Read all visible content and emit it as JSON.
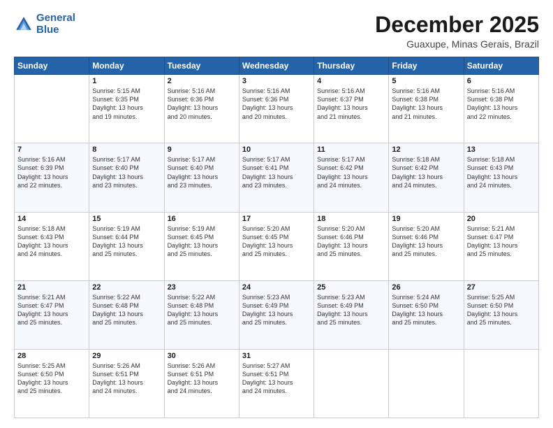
{
  "header": {
    "logo_line1": "General",
    "logo_line2": "Blue",
    "month": "December 2025",
    "location": "Guaxupe, Minas Gerais, Brazil"
  },
  "days_of_week": [
    "Sunday",
    "Monday",
    "Tuesday",
    "Wednesday",
    "Thursday",
    "Friday",
    "Saturday"
  ],
  "weeks": [
    [
      {
        "day": "",
        "info": ""
      },
      {
        "day": "1",
        "info": "Sunrise: 5:15 AM\nSunset: 6:35 PM\nDaylight: 13 hours\nand 19 minutes."
      },
      {
        "day": "2",
        "info": "Sunrise: 5:16 AM\nSunset: 6:36 PM\nDaylight: 13 hours\nand 20 minutes."
      },
      {
        "day": "3",
        "info": "Sunrise: 5:16 AM\nSunset: 6:36 PM\nDaylight: 13 hours\nand 20 minutes."
      },
      {
        "day": "4",
        "info": "Sunrise: 5:16 AM\nSunset: 6:37 PM\nDaylight: 13 hours\nand 21 minutes."
      },
      {
        "day": "5",
        "info": "Sunrise: 5:16 AM\nSunset: 6:38 PM\nDaylight: 13 hours\nand 21 minutes."
      },
      {
        "day": "6",
        "info": "Sunrise: 5:16 AM\nSunset: 6:38 PM\nDaylight: 13 hours\nand 22 minutes."
      }
    ],
    [
      {
        "day": "7",
        "info": "Sunrise: 5:16 AM\nSunset: 6:39 PM\nDaylight: 13 hours\nand 22 minutes."
      },
      {
        "day": "8",
        "info": "Sunrise: 5:17 AM\nSunset: 6:40 PM\nDaylight: 13 hours\nand 23 minutes."
      },
      {
        "day": "9",
        "info": "Sunrise: 5:17 AM\nSunset: 6:40 PM\nDaylight: 13 hours\nand 23 minutes."
      },
      {
        "day": "10",
        "info": "Sunrise: 5:17 AM\nSunset: 6:41 PM\nDaylight: 13 hours\nand 23 minutes."
      },
      {
        "day": "11",
        "info": "Sunrise: 5:17 AM\nSunset: 6:42 PM\nDaylight: 13 hours\nand 24 minutes."
      },
      {
        "day": "12",
        "info": "Sunrise: 5:18 AM\nSunset: 6:42 PM\nDaylight: 13 hours\nand 24 minutes."
      },
      {
        "day": "13",
        "info": "Sunrise: 5:18 AM\nSunset: 6:43 PM\nDaylight: 13 hours\nand 24 minutes."
      }
    ],
    [
      {
        "day": "14",
        "info": "Sunrise: 5:18 AM\nSunset: 6:43 PM\nDaylight: 13 hours\nand 24 minutes."
      },
      {
        "day": "15",
        "info": "Sunrise: 5:19 AM\nSunset: 6:44 PM\nDaylight: 13 hours\nand 25 minutes."
      },
      {
        "day": "16",
        "info": "Sunrise: 5:19 AM\nSunset: 6:45 PM\nDaylight: 13 hours\nand 25 minutes."
      },
      {
        "day": "17",
        "info": "Sunrise: 5:20 AM\nSunset: 6:45 PM\nDaylight: 13 hours\nand 25 minutes."
      },
      {
        "day": "18",
        "info": "Sunrise: 5:20 AM\nSunset: 6:46 PM\nDaylight: 13 hours\nand 25 minutes."
      },
      {
        "day": "19",
        "info": "Sunrise: 5:20 AM\nSunset: 6:46 PM\nDaylight: 13 hours\nand 25 minutes."
      },
      {
        "day": "20",
        "info": "Sunrise: 5:21 AM\nSunset: 6:47 PM\nDaylight: 13 hours\nand 25 minutes."
      }
    ],
    [
      {
        "day": "21",
        "info": "Sunrise: 5:21 AM\nSunset: 6:47 PM\nDaylight: 13 hours\nand 25 minutes."
      },
      {
        "day": "22",
        "info": "Sunrise: 5:22 AM\nSunset: 6:48 PM\nDaylight: 13 hours\nand 25 minutes."
      },
      {
        "day": "23",
        "info": "Sunrise: 5:22 AM\nSunset: 6:48 PM\nDaylight: 13 hours\nand 25 minutes."
      },
      {
        "day": "24",
        "info": "Sunrise: 5:23 AM\nSunset: 6:49 PM\nDaylight: 13 hours\nand 25 minutes."
      },
      {
        "day": "25",
        "info": "Sunrise: 5:23 AM\nSunset: 6:49 PM\nDaylight: 13 hours\nand 25 minutes."
      },
      {
        "day": "26",
        "info": "Sunrise: 5:24 AM\nSunset: 6:50 PM\nDaylight: 13 hours\nand 25 minutes."
      },
      {
        "day": "27",
        "info": "Sunrise: 5:25 AM\nSunset: 6:50 PM\nDaylight: 13 hours\nand 25 minutes."
      }
    ],
    [
      {
        "day": "28",
        "info": "Sunrise: 5:25 AM\nSunset: 6:50 PM\nDaylight: 13 hours\nand 25 minutes."
      },
      {
        "day": "29",
        "info": "Sunrise: 5:26 AM\nSunset: 6:51 PM\nDaylight: 13 hours\nand 24 minutes."
      },
      {
        "day": "30",
        "info": "Sunrise: 5:26 AM\nSunset: 6:51 PM\nDaylight: 13 hours\nand 24 minutes."
      },
      {
        "day": "31",
        "info": "Sunrise: 5:27 AM\nSunset: 6:51 PM\nDaylight: 13 hours\nand 24 minutes."
      },
      {
        "day": "",
        "info": ""
      },
      {
        "day": "",
        "info": ""
      },
      {
        "day": "",
        "info": ""
      }
    ]
  ]
}
